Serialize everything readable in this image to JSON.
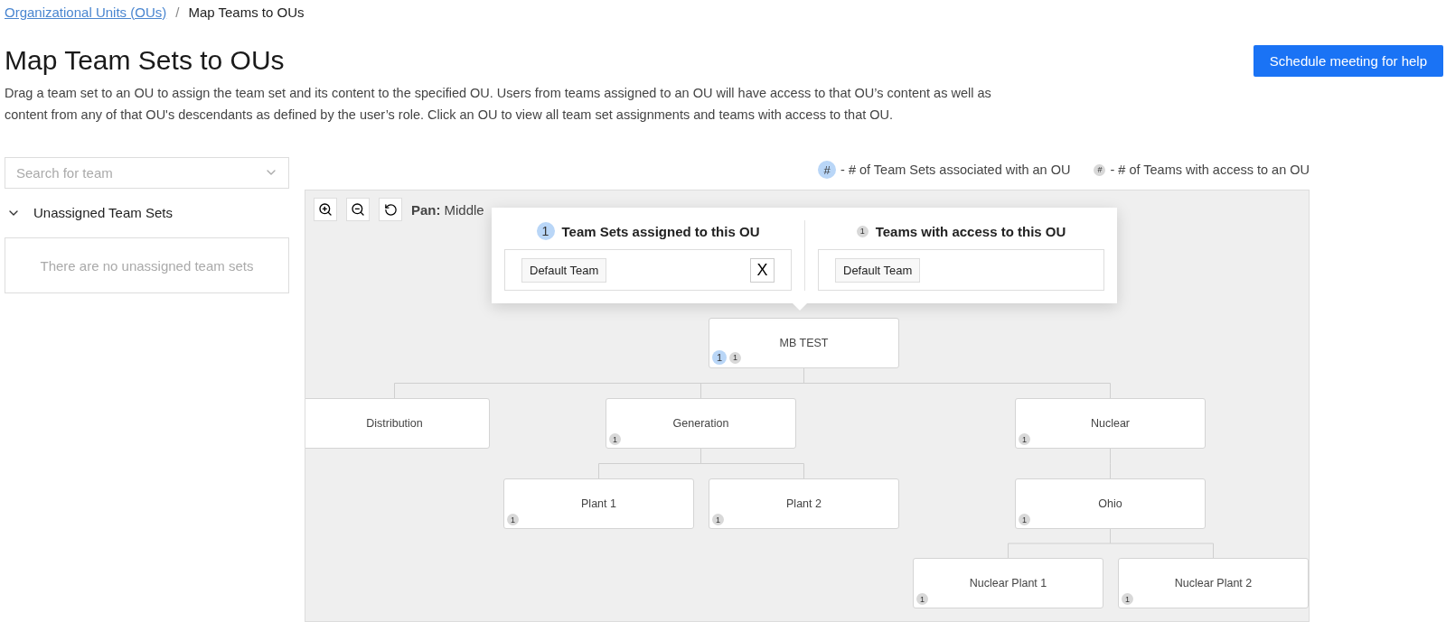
{
  "breadcrumb": [
    {
      "label": "Organizational Units (OUs)",
      "kind": "link"
    },
    {
      "label": "Map Teams to OUs",
      "kind": "current"
    }
  ],
  "breadcrumb_separator": "/",
  "title": "Map Team Sets to OUs",
  "description": "Drag a team set to an OU to assign the team set and its content to the specified OU. Users from teams assigned to an OU will have access to that OU’s content as well as content from any of that OU's descendants as defined by the user’s role. Click an OU to view all team set assignments and teams with access to that OU.",
  "help_button": "Schedule meeting for help",
  "search": {
    "placeholder": "Search for team"
  },
  "unassigned": {
    "label": "Unassigned Team Sets",
    "expanded": true,
    "empty_text": "There are no unassigned team sets"
  },
  "legend": [
    {
      "kind": "team_sets",
      "badge": "#",
      "text": "- # of Team Sets associated with an OU"
    },
    {
      "kind": "teams",
      "badge": "#",
      "text": "- # of Teams with access to an OU"
    }
  ],
  "canvas_hint": {
    "label": "Pan:",
    "text": "Middle"
  },
  "popup": {
    "sections": [
      {
        "kind": "team_sets",
        "badge": "1",
        "title": "Team Sets assigned to this OU",
        "chips": [
          "Default Team"
        ],
        "removable": true,
        "remove_label": "X"
      },
      {
        "kind": "teams",
        "badge": "1",
        "title": "Teams with access to this OU",
        "chips": [
          "Default Team"
        ],
        "removable": false
      }
    ]
  },
  "tree": {
    "label": "MB TEST",
    "team_sets": "1",
    "teams": "1",
    "children": [
      {
        "label": "Distribution"
      },
      {
        "label": "Generation",
        "teams": "1",
        "children": [
          {
            "label": "Plant 1",
            "teams": "1"
          },
          {
            "label": "Plant 2",
            "teams": "1"
          }
        ]
      },
      {
        "label": "Nuclear",
        "teams": "1",
        "children": [
          {
            "label": "Ohio",
            "teams": "1",
            "children": [
              {
                "label": "Nuclear Plant 1",
                "teams": "1"
              },
              {
                "label": "Nuclear Plant 2",
                "teams": "1"
              }
            ]
          }
        ]
      }
    ]
  }
}
